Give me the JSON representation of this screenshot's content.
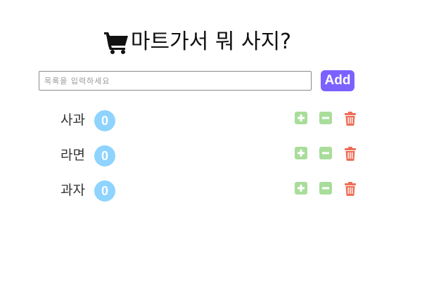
{
  "header": {
    "title": "마트가서 뭐 사지?",
    "icon": "cart-icon"
  },
  "add_form": {
    "placeholder": "목록을 입력하세요",
    "value": "",
    "button_label": "Add"
  },
  "items": [
    {
      "name": "사과",
      "count": "0"
    },
    {
      "name": "라면",
      "count": "0"
    },
    {
      "name": "과자",
      "count": "0"
    }
  ],
  "icons": {
    "increase": "plus-square-icon",
    "decrease": "minus-square-icon",
    "delete": "trash-icon"
  },
  "colors": {
    "accent": "#7b61ff",
    "badge": "#8fd3ff",
    "increase_decrease": "#a8dd9a",
    "delete": "#ee6e57"
  }
}
